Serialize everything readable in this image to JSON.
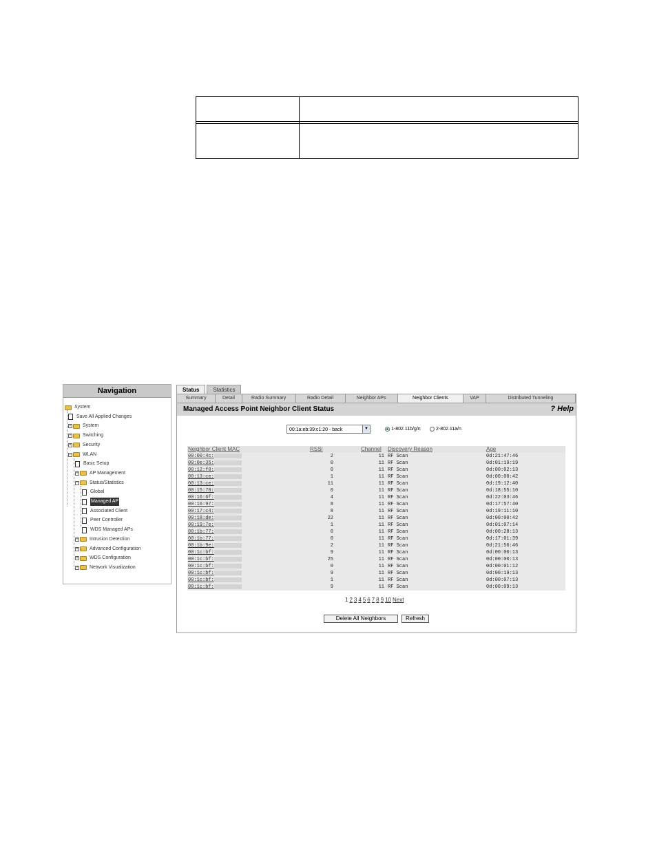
{
  "nav": {
    "title": "Navigation",
    "items": [
      {
        "label": "System",
        "icon": "folder-open-icon",
        "level": 0
      },
      {
        "label": "Save All Applied Changes",
        "icon": "document-icon",
        "level": 1
      },
      {
        "label": "System",
        "icon": "folder-icon",
        "level": 1
      },
      {
        "label": "Switching",
        "icon": "folder-icon",
        "level": 1
      },
      {
        "label": "Security",
        "icon": "folder-icon",
        "level": 1
      },
      {
        "label": "WLAN",
        "icon": "folder-open-icon",
        "level": 1
      },
      {
        "label": "Basic Setup",
        "icon": "document-icon",
        "level": 2
      },
      {
        "label": "AP Management",
        "icon": "folder-icon",
        "level": 2
      },
      {
        "label": "Status/Statistics",
        "icon": "folder-open-icon",
        "level": 2
      },
      {
        "label": "Global",
        "icon": "document-icon",
        "level": 3
      },
      {
        "label": "Managed AP",
        "icon": "document-icon",
        "level": 3,
        "selected": true
      },
      {
        "label": "Associated Client",
        "icon": "document-icon",
        "level": 3
      },
      {
        "label": "Peer Controller",
        "icon": "document-icon",
        "level": 3
      },
      {
        "label": "WDS Managed APs",
        "icon": "document-icon",
        "level": 3
      },
      {
        "label": "Intrusion Detection",
        "icon": "folder-icon",
        "level": 2
      },
      {
        "label": "Advanced Configuration",
        "icon": "folder-icon",
        "level": 2
      },
      {
        "label": "WDS Configuration",
        "icon": "folder-icon",
        "level": 2
      },
      {
        "label": "Network Visualization",
        "icon": "folder-icon",
        "level": 2
      }
    ]
  },
  "tabs_top": [
    {
      "label": "Status",
      "active": true
    },
    {
      "label": "Statistics",
      "active": false
    }
  ],
  "tabs_sub": [
    {
      "label": "Summary",
      "active": false
    },
    {
      "label": "Detail",
      "active": false
    },
    {
      "label": "Radio Summary",
      "active": false
    },
    {
      "label": "Radio Detail",
      "active": false
    },
    {
      "label": "Neighbor APs",
      "active": false
    },
    {
      "label": "Neighbor Clients",
      "active": true
    },
    {
      "label": "VAP",
      "active": false
    },
    {
      "label": "Distributed Tunneling",
      "active": false
    }
  ],
  "page": {
    "title": "Managed Access Point Neighbor Client Status",
    "help": "? Help"
  },
  "ap_select": {
    "value": "00:1a:eb:39:c1:20 - back"
  },
  "radio": {
    "option1": "1-802.11b/g/n",
    "option2": "2-802.11a/n",
    "selected": 1
  },
  "table": {
    "columns": [
      "Neighbor Client MAC",
      "RSSI",
      "Channel",
      "Discovery Reason",
      "Age"
    ],
    "rows": [
      {
        "mac": "00:00:4c:",
        "rssi": "2",
        "channel": "11",
        "reason": "RF Scan",
        "age": "0d:21:47:46"
      },
      {
        "mac": "00:0e:35:",
        "rssi": "0",
        "channel": "11",
        "reason": "RF Scan",
        "age": "0d:01:19:19"
      },
      {
        "mac": "00:12:f0:",
        "rssi": "0",
        "channel": "11",
        "reason": "RF Scan",
        "age": "0d:00:02:13"
      },
      {
        "mac": "00:13:ce:",
        "rssi": "1",
        "channel": "11",
        "reason": "RF Scan",
        "age": "0d:00:00:42"
      },
      {
        "mac": "00:13:ce:",
        "rssi": "11",
        "channel": "11",
        "reason": "RF Scan",
        "age": "0d:19:12:40"
      },
      {
        "mac": "00:15:70:",
        "rssi": "0",
        "channel": "11",
        "reason": "RF Scan",
        "age": "0d:18:55:10"
      },
      {
        "mac": "00:16:6f:",
        "rssi": "4",
        "channel": "11",
        "reason": "RF Scan",
        "age": "0d:22:03:46"
      },
      {
        "mac": "00:16:97:",
        "rssi": "8",
        "channel": "11",
        "reason": "RF Scan",
        "age": "0d:17:57:40"
      },
      {
        "mac": "00:17:c4:",
        "rssi": "8",
        "channel": "11",
        "reason": "RF Scan",
        "age": "0d:19:11:10"
      },
      {
        "mac": "00:18:de:",
        "rssi": "22",
        "channel": "11",
        "reason": "RF Scan",
        "age": "0d:00:00:42"
      },
      {
        "mac": "00:19:7e:",
        "rssi": "1",
        "channel": "11",
        "reason": "RF Scan",
        "age": "0d:01:07:14"
      },
      {
        "mac": "00:1b:77:",
        "rssi": "0",
        "channel": "11",
        "reason": "RF Scan",
        "age": "0d:00:28:13"
      },
      {
        "mac": "00:1b:77:",
        "rssi": "0",
        "channel": "11",
        "reason": "RF Scan",
        "age": "0d:17:01:39"
      },
      {
        "mac": "00:1b:9e:",
        "rssi": "2",
        "channel": "11",
        "reason": "RF Scan",
        "age": "0d:21:56:46"
      },
      {
        "mac": "00:1c:bf:",
        "rssi": "9",
        "channel": "11",
        "reason": "RF Scan",
        "age": "0d:00:00:13"
      },
      {
        "mac": "00:1c:bf:",
        "rssi": "25",
        "channel": "11",
        "reason": "RF Scan",
        "age": "0d:00:00:13"
      },
      {
        "mac": "00:1c:bf:",
        "rssi": "0",
        "channel": "11",
        "reason": "RF Scan",
        "age": "0d:00:01:12"
      },
      {
        "mac": "00:1c:bf:",
        "rssi": "9",
        "channel": "11",
        "reason": "RF Scan",
        "age": "0d:00:19:13"
      },
      {
        "mac": "00:1c:bf:",
        "rssi": "1",
        "channel": "11",
        "reason": "RF Scan",
        "age": "0d:00:07:13"
      },
      {
        "mac": "00:1c:bf:",
        "rssi": "9",
        "channel": "11",
        "reason": "RF Scan",
        "age": "0d:00:09:13"
      }
    ]
  },
  "pager": {
    "pages": [
      "1",
      "2",
      "3",
      "4",
      "5",
      "6",
      "7",
      "8",
      "9",
      "10"
    ],
    "current": "1",
    "next": "Next"
  },
  "buttons": {
    "delete_all": "Delete All Neighbors",
    "refresh": "Refresh"
  }
}
